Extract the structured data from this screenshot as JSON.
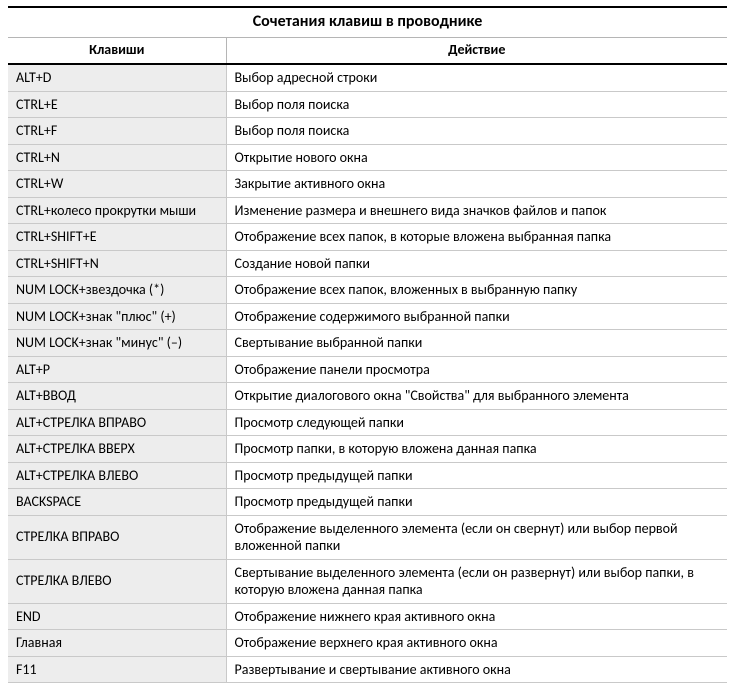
{
  "title": "Сочетания клавиш в проводнике",
  "headers": {
    "keys": "Клавиши",
    "action": "Действие"
  },
  "rows": [
    {
      "key": "ALT+D",
      "action": "Выбор адресной строки"
    },
    {
      "key": "CTRL+E",
      "action": "Выбор поля поиска"
    },
    {
      "key": "CTRL+F",
      "action": "Выбор поля поиска"
    },
    {
      "key": "CTRL+N",
      "action": "Открытие нового окна"
    },
    {
      "key": "CTRL+W",
      "action": "Закрытие активного окна"
    },
    {
      "key": "CTRL+колесо прокрутки мыши",
      "action": "Изменение размера и внешнего вида значков файлов и папок"
    },
    {
      "key": "CTRL+SHIFT+E",
      "action": "Отображение всех папок, в которые вложена выбранная папка"
    },
    {
      "key": "CTRL+SHIFT+N",
      "action": "Создание новой папки"
    },
    {
      "key": "NUM LOCK+звездочка (*)",
      "action": "Отображение всех папок, вложенных в выбранную папку"
    },
    {
      "key": "NUM LOCK+знак \"плюс\" (+)",
      "action": "Отображение содержимого выбранной папки"
    },
    {
      "key": "NUM LOCK+знак \"минус\" (–)",
      "action": "Свертывание выбранной папки"
    },
    {
      "key": "ALT+P",
      "action": "Отображение панели просмотра"
    },
    {
      "key": "ALT+ВВОД",
      "action": "Открытие диалогового окна \"Свойства\" для выбранного элемента"
    },
    {
      "key": "ALT+СТРЕЛКА ВПРАВО",
      "action": "Просмотр следующей папки"
    },
    {
      "key": "ALT+СТРЕЛКА ВВЕРХ",
      "action": "Просмотр папки, в которую вложена данная папка"
    },
    {
      "key": "ALT+СТРЕЛКА ВЛЕВО",
      "action": "Просмотр предыдущей папки"
    },
    {
      "key": "BACKSPACE",
      "action": "Просмотр предыдущей папки"
    },
    {
      "key": "СТРЕЛКА ВПРАВО",
      "action": "Отображение выделенного элемента (если он свернут) или выбор первой вложенной папки"
    },
    {
      "key": "СТРЕЛКА ВЛЕВО",
      "action": "Свертывание выделенного элемента (если он развернут) или выбор папки, в которую вложена данная папка"
    },
    {
      "key": "END",
      "action": "Отображение нижнего края активного окна"
    },
    {
      "key": "Главная",
      "action": "Отображение верхнего края активного окна"
    },
    {
      "key": "F11",
      "action": "Развертывание и свертывание активного окна"
    }
  ]
}
